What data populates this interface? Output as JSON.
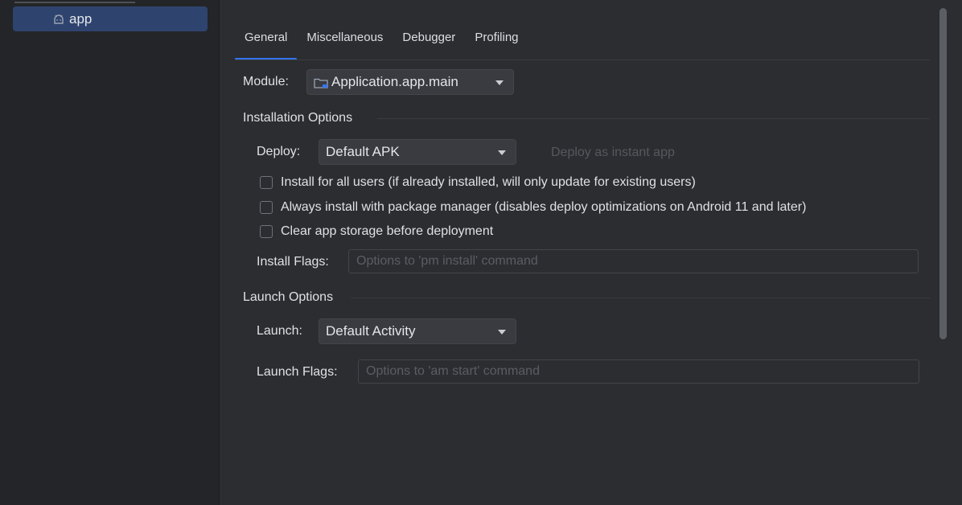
{
  "sidebar": {
    "selected_item": {
      "label": "app",
      "icon": "android-icon"
    }
  },
  "tabs": [
    {
      "label": "General",
      "active": true
    },
    {
      "label": "Miscellaneous",
      "active": false
    },
    {
      "label": "Debugger",
      "active": false
    },
    {
      "label": "Profiling",
      "active": false
    }
  ],
  "module": {
    "label": "Module:",
    "value": "Application.app.main",
    "icon": "folder-icon"
  },
  "installation": {
    "title": "Installation Options",
    "deploy_label": "Deploy:",
    "deploy_value": "Default APK",
    "instant_app_label": "Deploy as instant app",
    "checkboxes": [
      {
        "label": "Install for all users (if already installed, will only update for existing users)",
        "checked": false
      },
      {
        "label": "Always install with package manager (disables deploy optimizations on Android 11 and later)",
        "checked": false
      },
      {
        "label": "Clear app storage before deployment",
        "checked": false
      }
    ],
    "flags_label": "Install Flags:",
    "flags_placeholder": "Options to 'pm install' command",
    "flags_value": ""
  },
  "launch": {
    "title": "Launch Options",
    "launch_label": "Launch:",
    "launch_value": "Default Activity",
    "flags_label": "Launch Flags:",
    "flags_placeholder": "Options to 'am start' command",
    "flags_value": ""
  },
  "colors": {
    "accent": "#3574f0",
    "selection": "#2e436e",
    "background": "#2b2d30"
  }
}
